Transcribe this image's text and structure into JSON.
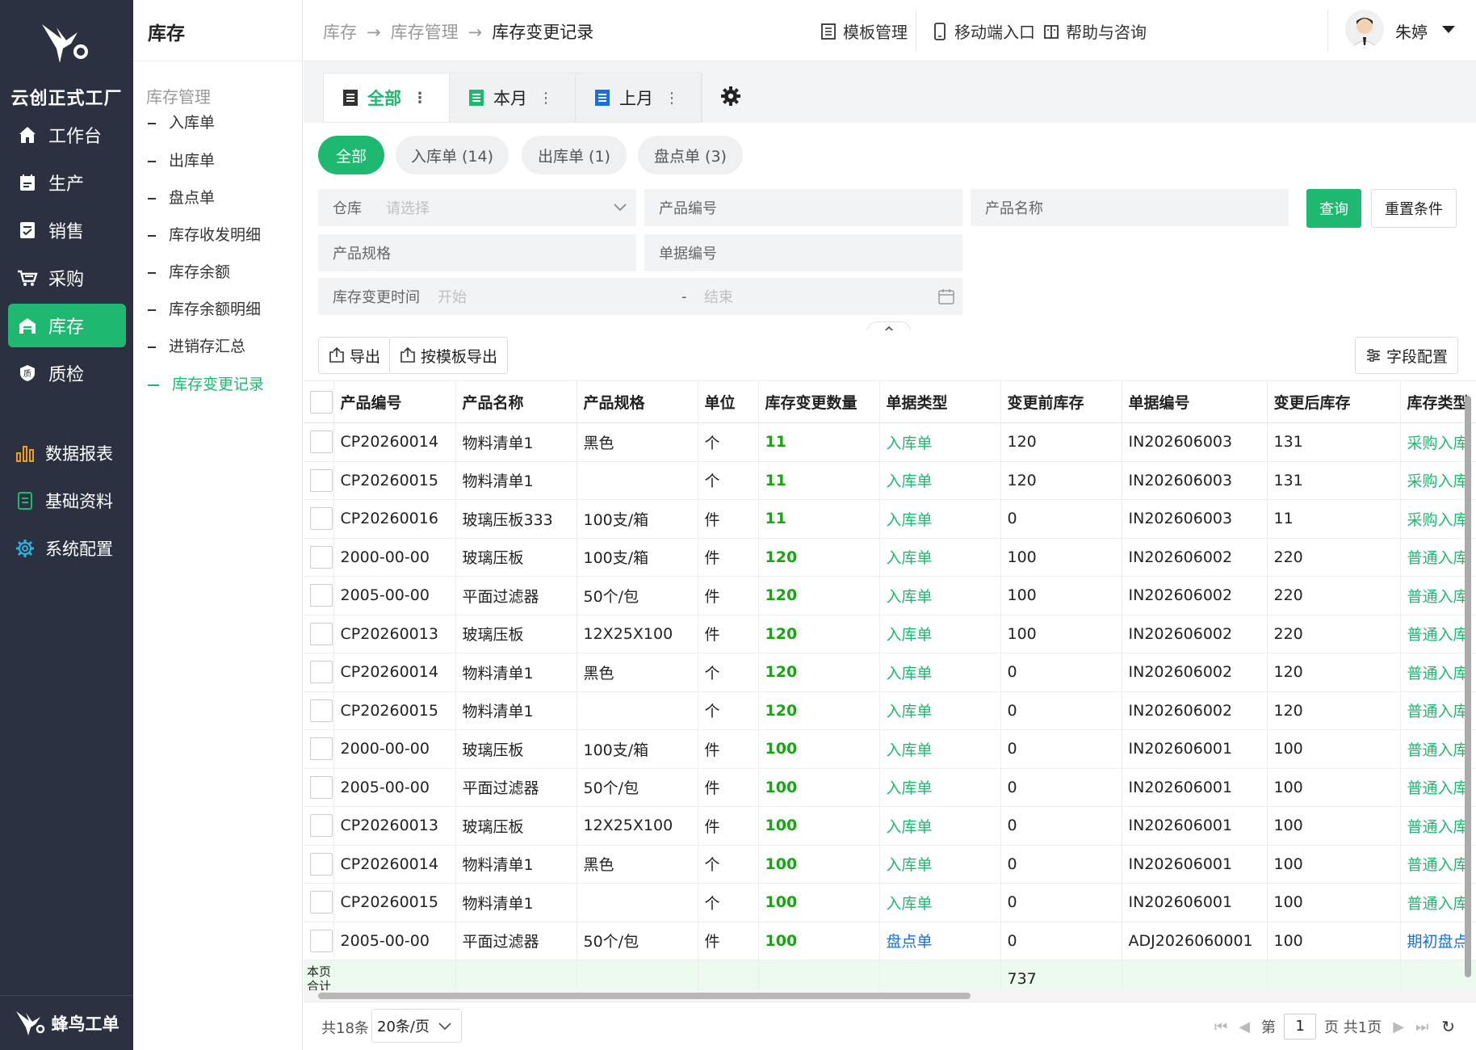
{
  "sidebar": {
    "brand": "云创正式工厂",
    "footer": "蜂鸟工单",
    "items": [
      {
        "label": "工作台",
        "icon": "home-icon"
      },
      {
        "label": "生产",
        "icon": "production-icon"
      },
      {
        "label": "销售",
        "icon": "sales-icon"
      },
      {
        "label": "采购",
        "icon": "cart-icon"
      },
      {
        "label": "库存",
        "icon": "warehouse-icon",
        "active": true
      },
      {
        "label": "质检",
        "icon": "shield-icon"
      }
    ],
    "items2": [
      {
        "label": "数据报表",
        "icon": "bar-chart-icon"
      },
      {
        "label": "基础资料",
        "icon": "document-icon"
      },
      {
        "label": "系统配置",
        "icon": "gear-icon"
      }
    ],
    "accent": "#1fb870",
    "bg": "#2b3140"
  },
  "submenu": {
    "title": "库存",
    "group": "库存管理",
    "items": [
      "入库单",
      "出库单",
      "盘点单",
      "库存收发明细",
      "库存余额",
      "库存余额明细",
      "进销存汇总",
      "库存变更记录"
    ],
    "active_index": 7
  },
  "topbar": {
    "breadcrumb": [
      "库存",
      "库存管理",
      "库存变更记录"
    ],
    "links": [
      "模板管理",
      "移动端入口",
      "帮助与咨询"
    ],
    "username": "朱婷"
  },
  "views": [
    {
      "label": "全部",
      "active": true
    },
    {
      "label": "本月"
    },
    {
      "label": "上月"
    }
  ],
  "filters": {
    "pills": [
      "全部",
      "入库单 (14)",
      "出库单 (1)",
      "盘点单 (3)"
    ],
    "warehouse_label": "仓库",
    "warehouse_placeholder": "请选择",
    "product_code_placeholder": "产品编号",
    "product_name_placeholder": "产品名称",
    "product_spec_placeholder": "产品规格",
    "doc_no_placeholder": "单据编号",
    "time_label": "库存变更时间",
    "time_start": "开始",
    "time_sep": "-",
    "time_end": "结束",
    "query": "查询",
    "reset": "重置条件"
  },
  "toolbar": {
    "export": "导出",
    "template_export": "按模板导出",
    "field_config": "字段配置"
  },
  "table": {
    "columns": [
      "产品编号",
      "产品名称",
      "产品规格",
      "单位",
      "库存变更数量",
      "单据类型",
      "变更前库存",
      "单据编号",
      "变更后库存",
      "库存类型"
    ],
    "rows": [
      [
        "CP20260014",
        "物料清单1",
        "黑色",
        "个",
        "11",
        "入库单",
        "120",
        "IN202606003",
        "131",
        "采购入库"
      ],
      [
        "CP20260015",
        "物料清单1",
        "",
        "个",
        "11",
        "入库单",
        "120",
        "IN202606003",
        "131",
        "采购入库"
      ],
      [
        "CP20260016",
        "玻璃压板333",
        "100支/箱",
        "件",
        "11",
        "入库单",
        "0",
        "IN202606003",
        "11",
        "采购入库"
      ],
      [
        "2000-00-00",
        "玻璃压板",
        "100支/箱",
        "件",
        "120",
        "入库单",
        "100",
        "IN202606002",
        "220",
        "普通入库"
      ],
      [
        "2005-00-00",
        "平面过滤器",
        "50个/包",
        "件",
        "120",
        "入库单",
        "100",
        "IN202606002",
        "220",
        "普通入库"
      ],
      [
        "CP20260013",
        "玻璃压板",
        "12X25X100",
        "件",
        "120",
        "入库单",
        "100",
        "IN202606002",
        "220",
        "普通入库"
      ],
      [
        "CP20260014",
        "物料清单1",
        "黑色",
        "个",
        "120",
        "入库单",
        "0",
        "IN202606002",
        "120",
        "普通入库"
      ],
      [
        "CP20260015",
        "物料清单1",
        "",
        "个",
        "120",
        "入库单",
        "0",
        "IN202606002",
        "120",
        "普通入库"
      ],
      [
        "2000-00-00",
        "玻璃压板",
        "100支/箱",
        "件",
        "100",
        "入库单",
        "0",
        "IN202606001",
        "100",
        "普通入库"
      ],
      [
        "2005-00-00",
        "平面过滤器",
        "50个/包",
        "件",
        "100",
        "入库单",
        "0",
        "IN202606001",
        "100",
        "普通入库"
      ],
      [
        "CP20260013",
        "玻璃压板",
        "12X25X100",
        "件",
        "100",
        "入库单",
        "0",
        "IN202606001",
        "100",
        "普通入库"
      ],
      [
        "CP20260014",
        "物料清单1",
        "黑色",
        "个",
        "100",
        "入库单",
        "0",
        "IN202606001",
        "100",
        "普通入库"
      ],
      [
        "CP20260015",
        "物料清单1",
        "",
        "个",
        "100",
        "入库单",
        "0",
        "IN202606001",
        "100",
        "普通入库"
      ],
      [
        "2005-00-00",
        "平面过滤器",
        "50个/包",
        "件",
        "100",
        "盘点单",
        "0",
        "ADJ2026060001",
        "100",
        "期初盘点"
      ]
    ],
    "summary_label": "本页合计",
    "summary_value": "737"
  },
  "pager": {
    "total": "共18条",
    "page_size": "20条/页",
    "page_prefix": "第",
    "page": "1",
    "page_suffix": "页 共1页"
  }
}
